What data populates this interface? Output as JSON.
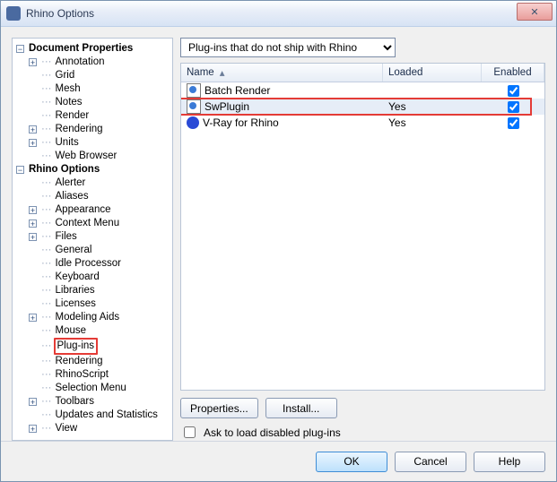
{
  "window": {
    "title": "Rhino Options"
  },
  "tree": {
    "doc_props": {
      "label": "Document Properties",
      "items": [
        "Annotation",
        "Grid",
        "Mesh",
        "Notes",
        "Render",
        "Rendering",
        "Units",
        "Web Browser"
      ],
      "expandable": [
        true,
        false,
        false,
        false,
        false,
        true,
        true,
        false
      ]
    },
    "rhino_opts": {
      "label": "Rhino Options",
      "items": [
        "Alerter",
        "Aliases",
        "Appearance",
        "Context Menu",
        "Files",
        "General",
        "Idle Processor",
        "Keyboard",
        "Libraries",
        "Licenses",
        "Modeling Aids",
        "Mouse",
        "Plug-ins",
        "Rendering",
        "RhinoScript",
        "Selection Menu",
        "Toolbars",
        "Updates and Statistics",
        "View"
      ],
      "expandable": [
        false,
        false,
        true,
        true,
        true,
        false,
        false,
        false,
        false,
        false,
        true,
        false,
        false,
        false,
        false,
        false,
        true,
        false,
        true
      ],
      "selected_index": 12
    }
  },
  "right": {
    "filter": {
      "selected": "Plug-ins that do not ship with Rhino"
    },
    "grid": {
      "headers": {
        "name": "Name",
        "loaded": "Loaded",
        "enabled": "Enabled"
      },
      "rows": [
        {
          "icon": "plugin",
          "name": "Batch Render",
          "loaded": "",
          "enabled": true,
          "selected": false,
          "hl": false
        },
        {
          "icon": "plugin",
          "name": "SwPlugin",
          "loaded": "Yes",
          "enabled": true,
          "selected": true,
          "hl": true
        },
        {
          "icon": "ball",
          "name": "V-Ray for Rhino",
          "loaded": "Yes",
          "enabled": true,
          "selected": false,
          "hl": false
        }
      ]
    },
    "buttons": {
      "properties": "Properties...",
      "install": "Install..."
    },
    "ask_disabled": {
      "label": "Ask to load disabled plug-ins",
      "checked": false
    }
  },
  "footer": {
    "ok": "OK",
    "cancel": "Cancel",
    "help": "Help"
  }
}
